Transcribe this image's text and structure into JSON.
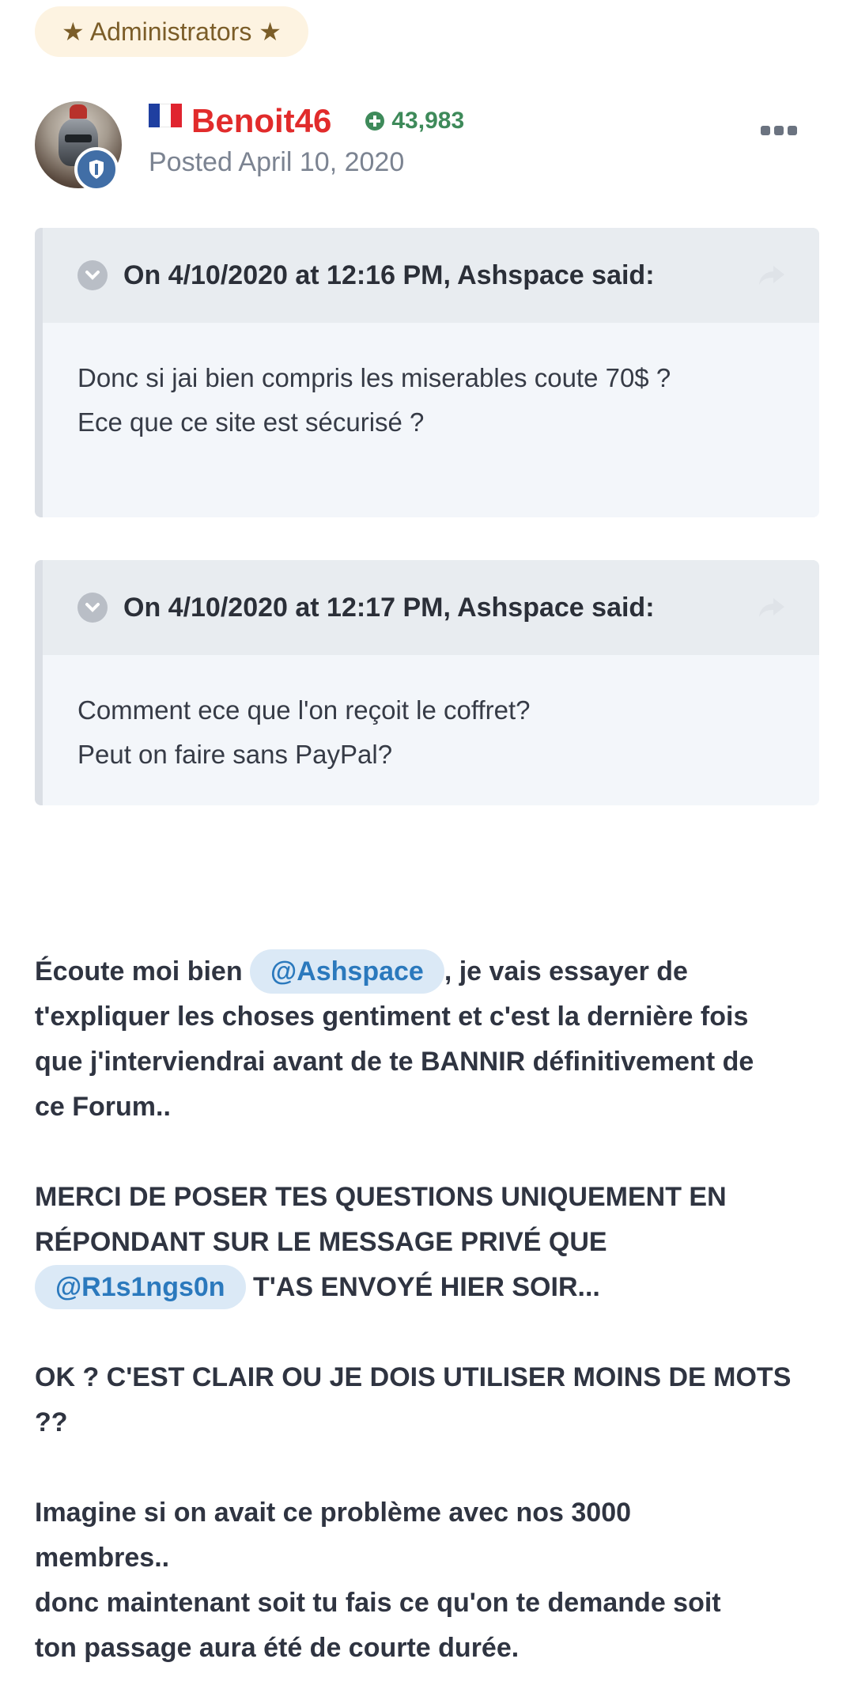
{
  "badge": {
    "label": "★ Administrators ★"
  },
  "author": {
    "name": "Benoit46",
    "reputation": "43,983",
    "posted": "Posted April 10, 2020",
    "country_flag": "france-flag-icon"
  },
  "quotes": [
    {
      "title": "On 4/10/2020 at 12:16 PM, Ashspace said:",
      "lines": [
        "Donc si jai bien compris les miserables coute 70$ ?",
        "Ece que ce site est sécurisé ?"
      ]
    },
    {
      "title": "On 4/10/2020 at 12:17 PM, Ashspace said:",
      "lines": [
        "Comment ece que l'on reçoit le coffret?",
        "Peut on faire sans PayPal?"
      ]
    }
  ],
  "content": {
    "p1": {
      "before": "Écoute moi bien ",
      "mention": "@Ashspace",
      "after_line1": ", je vais essayer de",
      "line2": "t'expliquer les choses gentiment et c'est la dernière fois",
      "line3": "que j'interviendrai avant de te BANNIR définitivement de",
      "line4": "ce Forum.."
    },
    "p2": {
      "line1": "MERCI DE POSER TES QUESTIONS UNIQUEMENT EN",
      "line2": "RÉPONDANT SUR LE MESSAGE PRIVÉ QUE",
      "mention": "@R1s1ngs0n",
      "after": " T'AS ENVOYÉ HIER SOIR..."
    },
    "p3": {
      "line1": "OK ? C'EST CLAIR OU JE DOIS UTILISER MOINS DE MOTS",
      "line2": "??"
    },
    "p4": {
      "line1": "Imagine si on avait ce problème avec nos 3000",
      "line2": "membres..",
      "line3": "donc maintenant soit tu fais ce qu'on te demande soit",
      "line4": "ton passage aura été de courte durée."
    }
  },
  "colors": {
    "username": "#e12b2b",
    "reputation": "#3e8a5a",
    "mention_bg": "#dbe9f6",
    "mention_text": "#2b79bd",
    "badge_bg": "#fdf3e1",
    "badge_text": "#7b5d28"
  }
}
